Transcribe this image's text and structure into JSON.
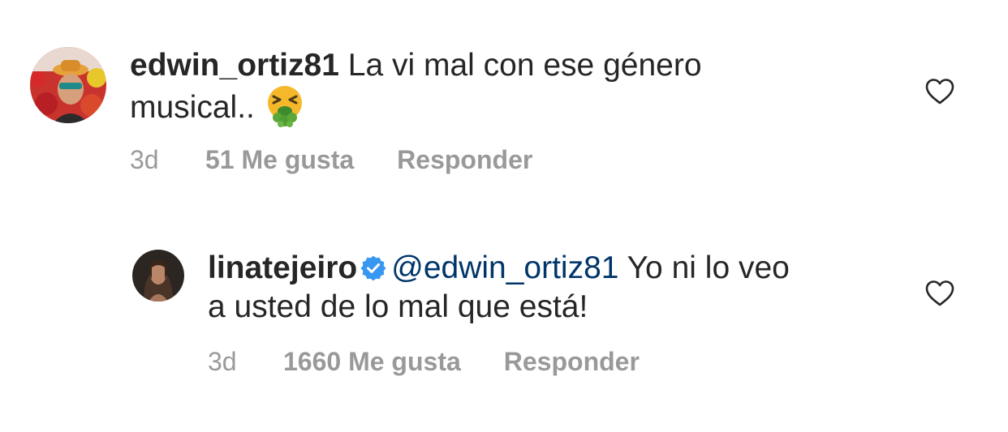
{
  "comments": [
    {
      "username": "edwin_ortiz81",
      "text_line1": "La vi mal con ese género",
      "text_line2": "musical..",
      "emoji": "nauseated-vomit-emoji",
      "time": "3d",
      "likes": "51 Me gusta",
      "reply": "Responder",
      "verified": false
    },
    {
      "username": "linatejeiro",
      "mention": "@edwin_ortiz81",
      "text_line1_rest": "Yo ni lo veo",
      "text_line2": "a usted de lo mal que está!",
      "time": "3d",
      "likes": "1660 Me gusta",
      "reply": "Responder",
      "verified": true
    }
  ],
  "colors": {
    "text": "#262626",
    "secondary": "#8e8e8e",
    "mention": "#003569",
    "verified": "#3897f0"
  }
}
